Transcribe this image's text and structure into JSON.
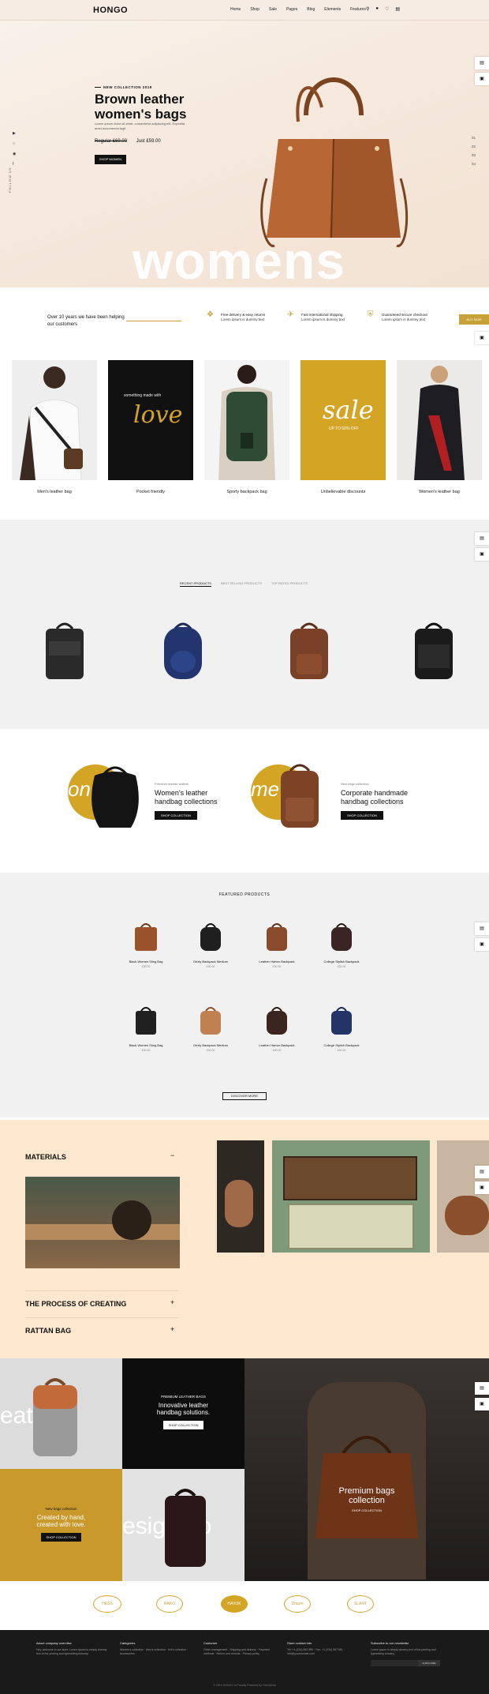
{
  "header": {
    "logo": "HONGO",
    "nav": [
      "Home",
      "Shop",
      "Sale",
      "Pages",
      "Blog",
      "Elements",
      "Features"
    ]
  },
  "hero": {
    "tag": "NEW COLLECTION 2019",
    "title": "Brown leather women's bags",
    "desc": "Lorem ipsum dolor sit amet, consectetur adipiscing elit. Expedita amet accumenda fugit",
    "price_regular_label": "Regular",
    "price_regular": "£69.00",
    "price_just_label": "Just",
    "price_just": "£59.00",
    "button": "SHOP WOMEN",
    "big_word": "womens",
    "follow": "FOLLOW US",
    "slides": [
      "01",
      "02",
      "03",
      "04"
    ]
  },
  "info": {
    "text": "Over 10 years we have been helping our customers",
    "features": [
      {
        "title": "Free delivery & easy returns",
        "sub": "Lorem ipsum is dummy text"
      },
      {
        "title": "Fast international shipping",
        "sub": "Lorem ipsum is dummy text"
      },
      {
        "title": "Guaranteed secure checkout",
        "sub": "Lorem ipsum is dummy text"
      }
    ],
    "buy_now": "BUY NOW"
  },
  "categories": [
    {
      "label": "Men's leather bag"
    },
    {
      "label": "Pocket friendly",
      "overlay": "love",
      "overlay_top": "something made with"
    },
    {
      "label": "Sporty backpack bag"
    },
    {
      "label": "Unbelievable discounts",
      "overlay": "sale",
      "overlay_sub": "UP TO 50% OFF"
    },
    {
      "label": "Women's leather bag"
    }
  ],
  "product_tabs": [
    "RECENT PRODUCTS",
    "BEST SELLING PRODUCTS",
    "TOP RATED PRODUCTS"
  ],
  "promos": [
    {
      "sub": "Premium leather wallets",
      "title": "Women's leather handbag collections",
      "button": "SHOP COLLECTION",
      "circle_text": "on"
    },
    {
      "sub": "New bags collection",
      "title": "Corporate handmade handbag collections",
      "button": "SHOP COLLECTION",
      "circle_text": "me"
    }
  ],
  "featured": {
    "title": "FEATURED PRODUCTS",
    "items": [
      {
        "name": "Black Women Sling Bag",
        "price": "£30.00"
      },
      {
        "name": "Grizly Backpack Medium",
        "price": "£30.00"
      },
      {
        "name": "Leather Harton Backpack",
        "price": "£30.00"
      },
      {
        "name": "College Stylish Backpack",
        "price": "£30.00"
      },
      {
        "name": "Black Women Sling Bag",
        "price": "£30.00"
      },
      {
        "name": "Grizly Backpack Medium",
        "price": "£30.00"
      },
      {
        "name": "Leather Harton Backpack",
        "price": "£30.00"
      },
      {
        "name": "College Stylish Backpack",
        "price": "£30.00"
      }
    ],
    "button": "DISCOVER MORE"
  },
  "accordion": [
    {
      "title": "MATERIALS",
      "sign": "−"
    },
    {
      "title": "THE PROCESS OF CREATING",
      "sign": "+"
    },
    {
      "title": "RATTAN BAG",
      "sign": "+"
    }
  ],
  "banners": {
    "b1": {
      "sub": "PREMIUM LEATHER BAGS",
      "title": "Innovative leather handbag solutions.",
      "button": "SHOP COLLECTION"
    },
    "b2": {
      "sub": "New bags collection",
      "title": "Created by hand, created with love.",
      "button": "SHOP COLLECTION"
    },
    "b3": {
      "title": "Premium bags collection",
      "button": "SHOP COLLECTION"
    },
    "ghost1": "eat trer",
    "ghost2": "esig rleo"
  },
  "brand_logos": [
    "HESS",
    "RAKO",
    "HAVOK",
    "Draum",
    "SLANT"
  ],
  "footer": {
    "cols": [
      {
        "title": "About company overview",
        "text": "Hey, welcome to our store. Lorem ipsum is simply dummy text of the printing and typesetting industry."
      },
      {
        "title": "Categories",
        "text": "Women's collection · Men's collection · Kid's collection · Accessories"
      },
      {
        "title": "Customer",
        "text": "Order management · Shipping and delivery · Payment methods · Return and refunds · Privacy policy"
      },
      {
        "title": "Store contact info",
        "text": "Tel: +1 (234) 567 890 · Fax: +1 (234) 567 891 · info@yourdomain.com"
      },
      {
        "title": "Subscribe to our newsletter",
        "text": "Lorem ipsum is simply dummy text of the printing and typesetting industry."
      }
    ],
    "subscribe": "SUBSCRIBE",
    "copyright": "© 2019 HONGO is Proudly Powered by ThemeZaa"
  },
  "colors": {
    "accent": "#c9a13a",
    "hero_bg": "#f4e6d9",
    "peach": "#fde8cf",
    "dark": "#1a1a1a"
  }
}
